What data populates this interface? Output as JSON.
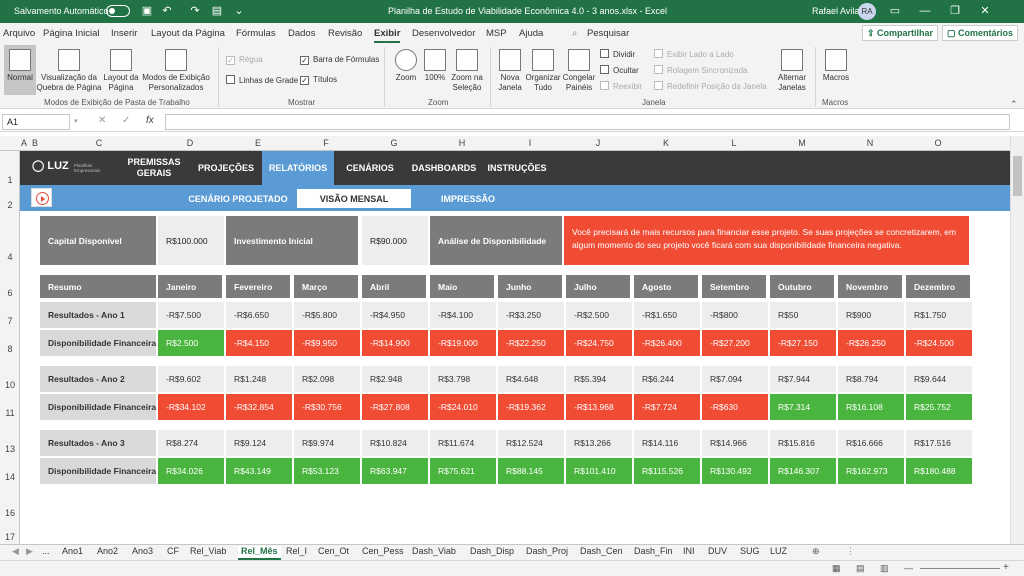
{
  "titlebar": {
    "autosave": "Salvamento Automático",
    "title": "Planilha de Estudo de Viabilidade Econômica 4.0 - 3 anos.xlsx  -  Excel",
    "user": "Rafael Avila",
    "initials": "RA"
  },
  "menu": [
    "Arquivo",
    "Página Inicial",
    "Inserir",
    "Layout da Página",
    "Fórmulas",
    "Dados",
    "Revisão",
    "Exibir",
    "Desenvolvedor",
    "MSP",
    "Ajuda"
  ],
  "search": "Pesquisar",
  "share": "Compartilhar",
  "comments": "Comentários",
  "ribbon": {
    "normal": "Normal",
    "page_break": "Visualização da Quebra de Página",
    "page_layout": "Layout da Página",
    "custom_views": "Modos de Exibição Personalizados",
    "group1": "Modos de Exibição de Pasta de Trabalho",
    "ruler": "Régua",
    "formula_bar": "Barra de Fórmulas",
    "gridlines": "Linhas de Grade",
    "headings": "Títulos",
    "group2": "Mostrar",
    "zoom": "Zoom",
    "zoom100": "100%",
    "zoom_sel": "Zoom na Seleção",
    "group3": "Zoom",
    "new_window": "Nova Janela",
    "arrange": "Organizar Tudo",
    "freeze": "Congelar Painéis",
    "split": "Dividir",
    "hide": "Ocultar",
    "unhide": "Reexibir",
    "side": "Exibir Lado a Lado",
    "sync": "Rolagem Sincronizada",
    "reset": "Redefinir Posição da Janela",
    "switch": "Alternar Janelas",
    "group4": "Janela",
    "macros": "Macros",
    "group5": "Macros"
  },
  "namebox": "A1",
  "columns": [
    "A",
    "B",
    "C",
    "D",
    "E",
    "F",
    "G",
    "H",
    "I",
    "J",
    "K",
    "L",
    "M",
    "N",
    "O"
  ],
  "rows": [
    "1",
    "2",
    "4",
    "6",
    "7",
    "8",
    "10",
    "11",
    "13",
    "14",
    "16",
    "17"
  ],
  "nav": {
    "logo": "LUZ",
    "logo_sub": "Planilhas Empresariais",
    "items": [
      "PREMISSAS GERAIS",
      "PROJEÇÕES",
      "RELATÓRIOS",
      "CENÁRIOS",
      "DASHBOARDS",
      "INSTRUÇÕES"
    ]
  },
  "subnav": [
    "CENÁRIO PROJETADO",
    "VISÃO MENSAL",
    "IMPRESSÃO"
  ],
  "summary": {
    "capital_label": "Capital Disponível",
    "capital_value": "R$100.000",
    "invest_label": "Investimento Inicial",
    "invest_value": "R$90.000",
    "analysis_label": "Análise de Disponibilidade",
    "alert": "Você precisará de mais recursos para financiar esse projeto. Se suas projeções se concretizarem, em algum momento do seu projeto você ficará com sua disponibilidade financeira negativa."
  },
  "table": {
    "header_label": "Resumo",
    "months": [
      "Janeiro",
      "Fevereiro",
      "Março",
      "Abril",
      "Maio",
      "Junho",
      "Julho",
      "Agosto",
      "Setembro",
      "Outubro",
      "Novembro",
      "Dezembro"
    ],
    "rows": [
      {
        "label": "Resultados - Ano 1",
        "values": [
          "-R$7.500",
          "-R$6.650",
          "-R$5.800",
          "-R$4.950",
          "-R$4.100",
          "-R$3.250",
          "-R$2.500",
          "-R$1.650",
          "-R$800",
          "R$50",
          "R$900",
          "R$1.750"
        ]
      },
      {
        "label": "Disponibilidade Financeira",
        "values": [
          "R$2.500",
          "-R$4.150",
          "-R$9.950",
          "-R$14.900",
          "-R$19.000",
          "-R$22.250",
          "-R$24.750",
          "-R$26.400",
          "-R$27.200",
          "-R$27.150",
          "-R$26.250",
          "-R$24.500"
        ]
      },
      {
        "label": "Resultados - Ano 2",
        "values": [
          "-R$9.602",
          "R$1.248",
          "R$2.098",
          "R$2.948",
          "R$3.798",
          "R$4.648",
          "R$5.394",
          "R$6.244",
          "R$7.094",
          "R$7.944",
          "R$8.794",
          "R$9.644"
        ]
      },
      {
        "label": "Disponibilidade Financeira",
        "values": [
          "-R$34.102",
          "-R$32.854",
          "-R$30.756",
          "-R$27.808",
          "-R$24.010",
          "-R$19.362",
          "-R$13.968",
          "-R$7.724",
          "-R$630",
          "R$7.314",
          "R$16.108",
          "R$25.752"
        ]
      },
      {
        "label": "Resultados - Ano 3",
        "values": [
          "R$8.274",
          "R$9.124",
          "R$9.974",
          "R$10.824",
          "R$11.674",
          "R$12.524",
          "R$13.266",
          "R$14.116",
          "R$14.966",
          "R$15.816",
          "R$16.666",
          "R$17.516"
        ]
      },
      {
        "label": "Disponibilidade Financeira",
        "values": [
          "R$34.026",
          "R$43.149",
          "R$53.123",
          "R$63.947",
          "R$75.621",
          "R$88.145",
          "R$101.410",
          "R$115.526",
          "R$130.492",
          "R$146.307",
          "R$162.973",
          "R$180.488"
        ]
      }
    ]
  },
  "colors": {
    "excel_green": "#217346",
    "negative": "#f04b33",
    "positive": "#4ab53e",
    "nav_blue": "#5b9bd5"
  },
  "sheet_tabs": [
    "...",
    "Ano1",
    "Ano2",
    "Ano3",
    "CF",
    "Rel_Viab",
    "Rel_Mês",
    "Rel_I",
    "Cen_Ot",
    "Cen_Pess",
    "Dash_Viab",
    "Dash_Disp",
    "Dash_Proj",
    "Dash_Cen",
    "Dash_Fin",
    "INI",
    "DUV",
    "SUG",
    "LUZ"
  ],
  "active_tab": "Rel_Mês"
}
